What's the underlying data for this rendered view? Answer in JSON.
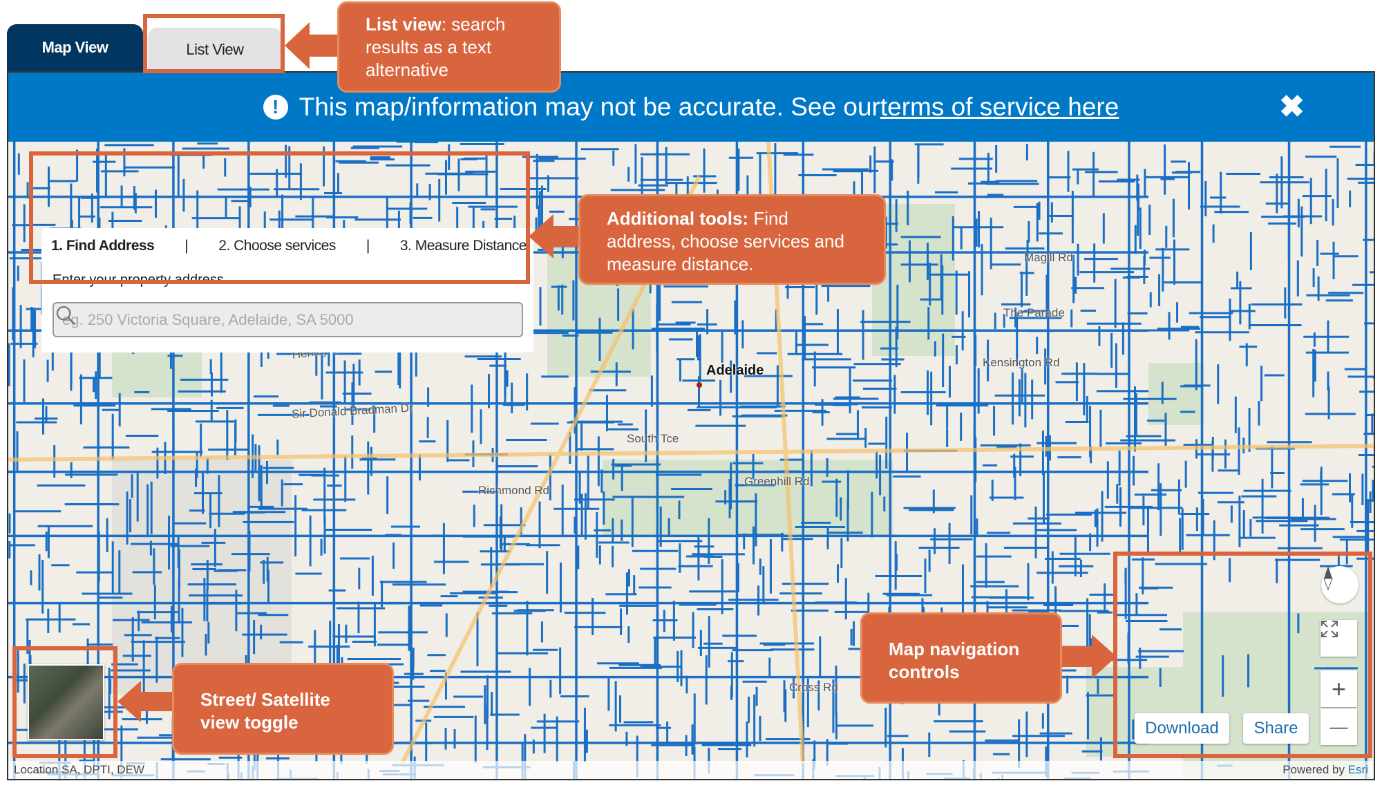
{
  "tabs": [
    {
      "label": "Map View",
      "active": true
    },
    {
      "label": "List View",
      "active": false
    }
  ],
  "banner": {
    "icon": "exclamation-circle-icon",
    "text": "This map/information may not be accurate. See our ",
    "link": "terms of service here",
    "close_icon": "close-icon",
    "close": "✖",
    "color": "#0078c8"
  },
  "panel": {
    "steps": [
      "1. Find Address",
      "|",
      "2. Choose services",
      "|",
      "3. Measure Distance"
    ],
    "label": "Enter your property address",
    "search_placeholder": "eg. 250 Victoria Square, Adelaide, SA 5000",
    "search_value": "",
    "search_icon": "search-icon"
  },
  "map": {
    "labels": [
      "Adelaide",
      "Henley Beach Rd",
      "Sir Donald Bradman Dr",
      "Richmond Rd",
      "Greenhill Rd",
      "The Parade",
      "Kensington Rd",
      "Magill Rd",
      "Cross Rd",
      "South Tce"
    ],
    "road_color": "#1a6fc4"
  },
  "controls": {
    "compass_icon": "compass-icon",
    "fullscreen_icon": "fullscreen-icon",
    "zoom_in": "+",
    "zoom_out": "—",
    "download": "Download",
    "share": "Share",
    "basemap_toggle": "satellite-thumbnail"
  },
  "attribution": {
    "left": "Location SA, DPTI, DEW",
    "right_prefix": "Powered by ",
    "right_link": "Esri"
  },
  "annotations": {
    "list_view": {
      "bold": "List view",
      "text": ": search results as a text alternative"
    },
    "tools": {
      "bold": "Additional tools: ",
      "text": "Find address, choose services and measure distance."
    },
    "nav": {
      "bold": "Map navigation controls"
    },
    "toggle": {
      "bold": "Street/ Satellite view toggle"
    },
    "color": "#d9653f"
  }
}
